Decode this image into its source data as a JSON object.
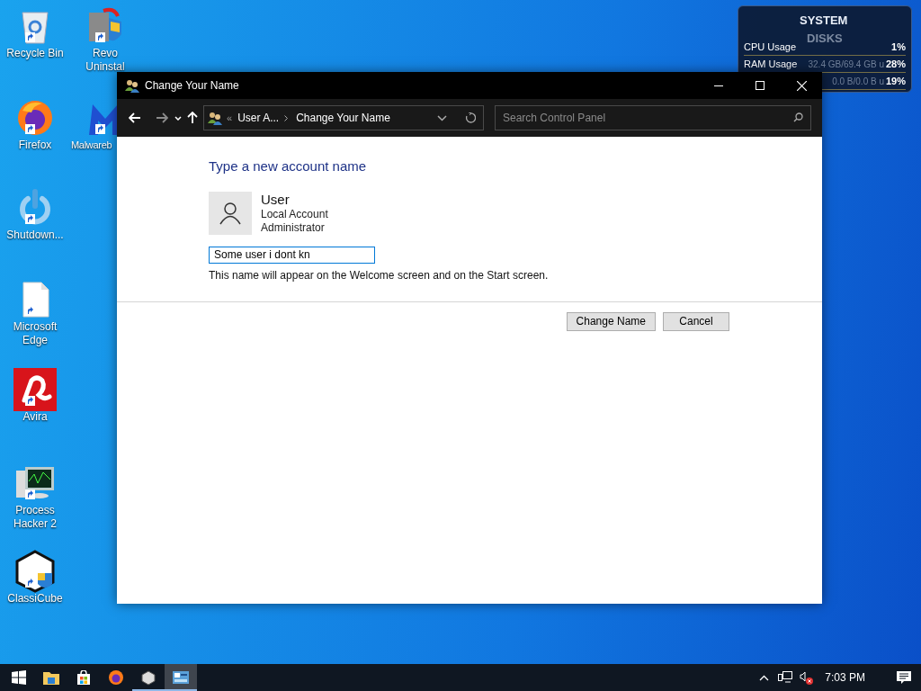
{
  "desktop_icons": [
    {
      "label": "Recycle Bin",
      "kind": "recycle"
    },
    {
      "label": "Revo Uninstal",
      "kind": "revo"
    },
    {
      "label": "Firefox",
      "kind": "firefox"
    },
    {
      "label": "Malwareb",
      "kind": "malware"
    },
    {
      "label": "Shutdown...",
      "kind": "power"
    },
    {
      "label": "Microsoft Edge",
      "kind": "file"
    },
    {
      "label": "Avira",
      "kind": "avira"
    },
    {
      "label": "Process Hacker 2",
      "kind": "monitor"
    },
    {
      "label": "ClassiCube",
      "kind": "cube"
    }
  ],
  "widget": {
    "title": "SYSTEM",
    "subtitle": "DISKS",
    "rows": [
      {
        "label": "CPU Usage",
        "reading": "",
        "percent": "1%"
      },
      {
        "label": "RAM Usage",
        "reading": "32.4 GB/69.4 GB u",
        "percent": "28%"
      },
      {
        "label": "",
        "reading": "0.0 B/0.0 B u",
        "percent": "19%"
      }
    ]
  },
  "window": {
    "title": "Change Your Name",
    "breadcrumb_overflow": "«",
    "breadcrumb": [
      "User A...",
      "Change Your Name"
    ],
    "search": {
      "placeholder": "Search Control Panel"
    },
    "heading": "Type a new account name",
    "user": {
      "name": "User",
      "lines": [
        "Local Account",
        "Administrator"
      ]
    },
    "name_field": {
      "value": "Some user i dont kn"
    },
    "hint": "This name will appear on the Welcome screen and on the Start screen.",
    "buttons": [
      "Change Name",
      "Cancel"
    ]
  },
  "taskbar": {
    "items": [
      {
        "kind": "explorer",
        "running": false,
        "selected": false
      },
      {
        "kind": "store",
        "running": false,
        "selected": false
      },
      {
        "kind": "firefox",
        "running": false,
        "selected": false
      },
      {
        "kind": "cube",
        "running": true,
        "selected": false
      },
      {
        "kind": "panel",
        "running": true,
        "selected": true
      }
    ],
    "clock": "7:03 PM"
  }
}
